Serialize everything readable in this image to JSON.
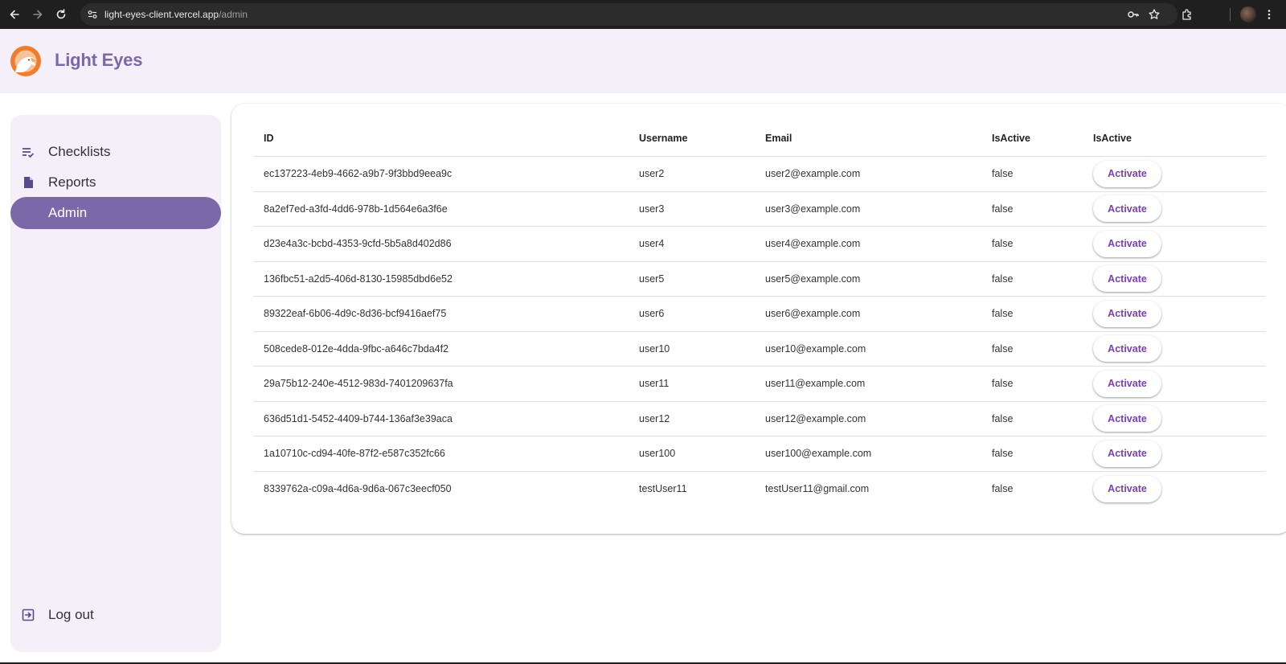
{
  "browser": {
    "url_host": "light-eyes-client.vercel.app",
    "url_path": "/admin"
  },
  "app": {
    "title": "Light Eyes"
  },
  "sidebar": {
    "items": [
      {
        "label": "Checklists",
        "icon": "checklist-icon",
        "active": false
      },
      {
        "label": "Reports",
        "icon": "document-icon",
        "active": false
      },
      {
        "label": "Admin",
        "icon": "",
        "active": true
      }
    ],
    "logout_label": "Log out"
  },
  "table": {
    "headers": [
      "ID",
      "Username",
      "Email",
      "IsActive",
      "IsActive"
    ],
    "action_label": "Activate",
    "rows": [
      {
        "id": "ec137223-4eb9-4662-a9b7-9f3bbd9eea9c",
        "username": "user2",
        "email": "user2@example.com",
        "is_active": "false"
      },
      {
        "id": "8a2ef7ed-a3fd-4dd6-978b-1d564e6a3f6e",
        "username": "user3",
        "email": "user3@example.com",
        "is_active": "false"
      },
      {
        "id": "d23e4a3c-bcbd-4353-9cfd-5b5a8d402d86",
        "username": "user4",
        "email": "user4@example.com",
        "is_active": "false"
      },
      {
        "id": "136fbc51-a2d5-406d-8130-15985dbd6e52",
        "username": "user5",
        "email": "user5@example.com",
        "is_active": "false"
      },
      {
        "id": "89322eaf-6b06-4d9c-8d36-bcf9416aef75",
        "username": "user6",
        "email": "user6@example.com",
        "is_active": "false"
      },
      {
        "id": "508cede8-012e-4dda-9fbc-a646c7bda4f2",
        "username": "user10",
        "email": "user10@example.com",
        "is_active": "false"
      },
      {
        "id": "29a75b12-240e-4512-983d-7401209637fa",
        "username": "user11",
        "email": "user11@example.com",
        "is_active": "false"
      },
      {
        "id": "636d51d1-5452-4409-b744-136af3e39aca",
        "username": "user12",
        "email": "user12@example.com",
        "is_active": "false"
      },
      {
        "id": "1a10710c-cd94-40fe-87f2-e587c352fc66",
        "username": "user100",
        "email": "user100@example.com",
        "is_active": "false"
      },
      {
        "id": "8339762a-c09a-4d6a-9d6a-067c3eecf050",
        "username": "testUser11",
        "email": "testUser11@gmail.com",
        "is_active": "false"
      }
    ]
  },
  "colors": {
    "accent": "#7b68a8",
    "header_bg": "#f4eff8",
    "button_text": "#7b3fb0"
  }
}
